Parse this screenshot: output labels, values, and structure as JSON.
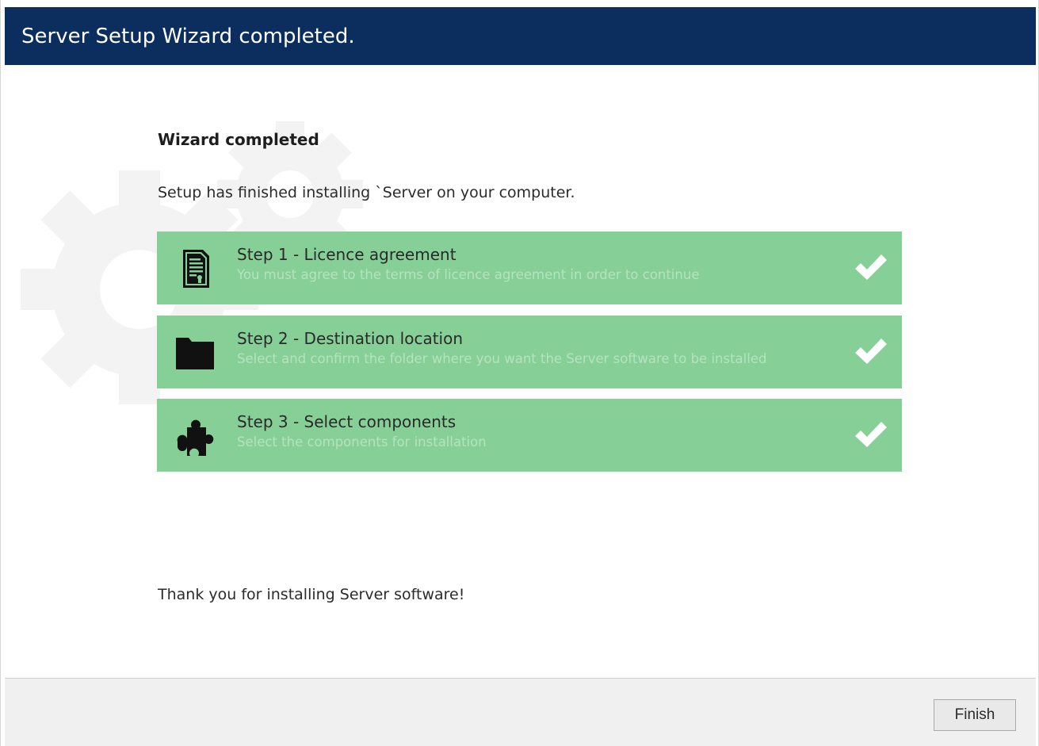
{
  "window": {
    "title": "Server Setup Wizard completed."
  },
  "content": {
    "heading": "Wizard completed",
    "intro": "Setup has finished installing `Server on your computer.",
    "steps": [
      {
        "title": "Step 1 - Licence agreement",
        "description": "You must agree to the terms of licence agreement in order to continue",
        "icon": "document-icon",
        "status": "completed"
      },
      {
        "title": "Step 2 - Destination location",
        "description": "Select and confirm the folder where you want the  Server software to be installed",
        "icon": "folder-icon",
        "status": "completed"
      },
      {
        "title": "Step 3 - Select components",
        "description": "Select the components for installation",
        "icon": "puzzle-icon",
        "status": "completed"
      }
    ],
    "thanks": "Thank you for installing Server software!"
  },
  "footer": {
    "finish_label": "Finish"
  },
  "colors": {
    "titlebar": "#0b2e5e",
    "step_background": "#86cf96",
    "step_description": "#b5e3bf",
    "footer_background": "#f0f0f0"
  }
}
